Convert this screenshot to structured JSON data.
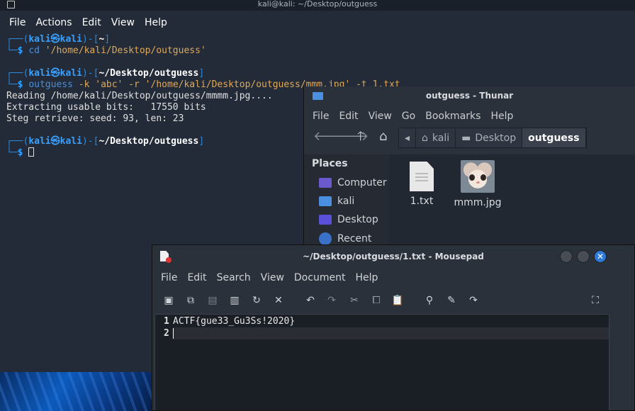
{
  "terminal": {
    "title": "kali@kali: ~/Desktop/outguess",
    "menu": [
      "File",
      "Actions",
      "Edit",
      "View",
      "Help"
    ],
    "prompt_user": "kali",
    "prompt_at": "㉿",
    "prompt_host": "kali",
    "prompt1_dir": "~",
    "cmd1_name": "cd",
    "cmd1_arg": "'/home/kali/Desktop/outguess'",
    "prompt2_dir": "~/Desktop/outguess",
    "cmd2_name": "outguess",
    "cmd2_args": " -k 'abc' -r '/home/kali/Desktop/outguess/mmm.jpg' -t 1.txt",
    "output": [
      "Reading /home/kali/Desktop/outguess/mmmm.jpg....",
      "Extracting usable bits:   17550 bits",
      "Steg retrieve: seed: 93, len: 23"
    ],
    "prompt3_dir": "~/Desktop/outguess"
  },
  "thunar": {
    "title": "outguess - Thunar",
    "menu": [
      "File",
      "Edit",
      "View",
      "Go",
      "Bookmarks",
      "Help"
    ],
    "path": [
      "kali",
      "Desktop",
      "outguess"
    ],
    "places_heading": "Places",
    "places": [
      "Computer",
      "kali",
      "Desktop",
      "Recent"
    ],
    "files": [
      "1.txt",
      "mmm.jpg"
    ]
  },
  "mousepad": {
    "title": "~/Desktop/outguess/1.txt - Mousepad",
    "menu": [
      "File",
      "Edit",
      "Search",
      "View",
      "Document",
      "Help"
    ],
    "lines": [
      {
        "num": "1",
        "text": "ACTF{gue33_Gu3Ss!2020}"
      },
      {
        "num": "2",
        "text": ""
      }
    ]
  },
  "icons": [
    "terminal-icon",
    "folder-icon",
    "back-arrow-icon",
    "forward-arrow-icon",
    "up-arrow-icon",
    "home-icon",
    "new-file-icon",
    "save-icon",
    "reload-icon",
    "undo-icon",
    "redo-icon",
    "cut-icon",
    "copy-icon",
    "paste-icon",
    "search-icon",
    "replace-icon",
    "goto-icon",
    "fullscreen-icon"
  ],
  "colors": {
    "accent": "#2f7ad8",
    "prompt": "#2f86d6",
    "string": "#e0a85a"
  }
}
